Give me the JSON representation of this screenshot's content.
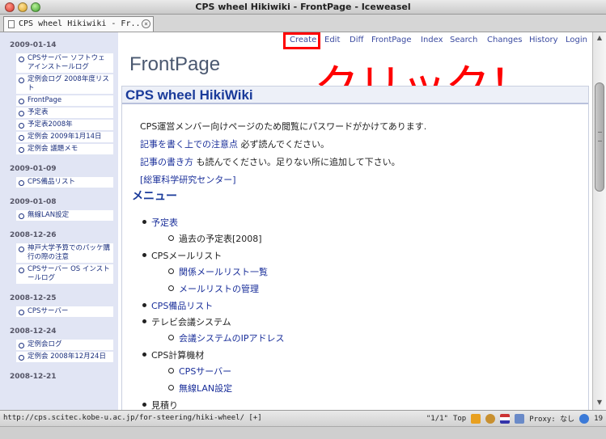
{
  "window": {
    "title": "CPS wheel Hikiwiki - FrontPage - Iceweasel"
  },
  "tab": {
    "label": "CPS wheel Hikiwiki - Fr..."
  },
  "nav": [
    "Create",
    "Edit",
    "Diff",
    "FrontPage",
    "Index",
    "Search",
    "Changes",
    "History",
    "Login"
  ],
  "page": {
    "title": "FrontPage",
    "annotation": "クリック！",
    "heading": "CPS wheel HikiWiki",
    "intro": "CPS運営メンバー向けページのため閲覧にパスワードがかけてあります.",
    "notice_link": "記事を書く上での注意点",
    "notice_rest": " 必ず読んでください。",
    "howto_link": "記事の書き方",
    "howto_rest": " も読んでください。足りない所に追加して下さい。",
    "center_link": "[総軍科学研究センター]",
    "menu_heading": "メニュー",
    "menu": {
      "m1": "予定表",
      "m1a": "過去の予定表[2008]",
      "m2": "CPSメールリスト",
      "m2a": "関係メールリスト一覧",
      "m2b": "メールリストの管理",
      "m3": "CPS備品リスト",
      "m4": "テレビ会議システム",
      "m4a": "会議システムのIPアドレス",
      "m5": "CPS計算機材",
      "m5a": "CPSサーバー",
      "m5b": "無線LAN設定",
      "m6": "見積り"
    }
  },
  "sidebar": {
    "d1": "2009-01-14",
    "d1_items": [
      "CPSサーバー ソフトウェアインストールログ",
      "定例会ログ 2008年度リスト",
      "FrontPage",
      "予定表",
      "予定表2008年",
      "定例会 2009年1月14日",
      "定例会 議題メモ"
    ],
    "d2": "2009-01-09",
    "d2_items": [
      "CPS備品リスト"
    ],
    "d3": "2009-01-08",
    "d3_items": [
      "無線LAN設定"
    ],
    "d4": "2008-12-26",
    "d4_items": [
      "神戸大学予算でのパッケ購行の際の注意",
      "CPSサーバー OS インストールログ"
    ],
    "d5": "2008-12-25",
    "d5_items": [
      "CPSサーバー"
    ],
    "d6": "2008-12-24",
    "d6_items": [
      "定例会ログ",
      "定例会 2008年12月24日"
    ],
    "d7": "2008-12-21"
  },
  "status": {
    "url": "http://cps.scitec.kobe-u.ac.jp/for-steering/hiki-wheel/ [+]",
    "page_count": "\"1/1\"",
    "position": "Top",
    "proxy": "Proxy: なし",
    "count": "19"
  }
}
